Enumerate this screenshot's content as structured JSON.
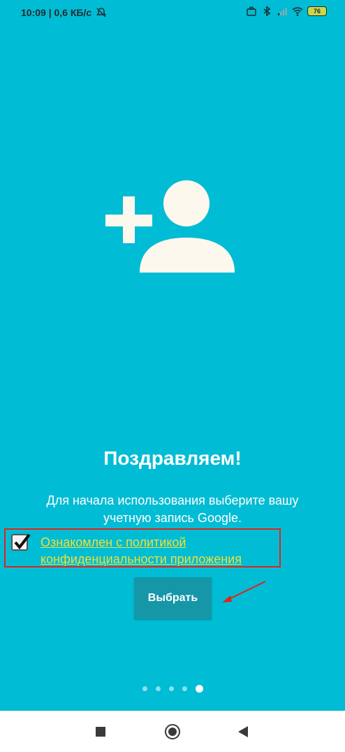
{
  "status_bar": {
    "time_speed": "10:09 | 0,6 КБ/с",
    "battery": "76",
    "icons": [
      "mute-bell-icon",
      "briefcase-icon",
      "bluetooth-icon",
      "signal-icon",
      "wifi-icon",
      "battery-icon"
    ]
  },
  "hero": {
    "icon": "add-person-icon",
    "color": "#FDF8EE"
  },
  "title": "Поздравляем!",
  "subtitle": "Для начала использования выберите вашу учетную запись Google.",
  "consent": {
    "checked": true,
    "link_text": "Ознакомлен с политикой конфиденциальности приложения"
  },
  "button": {
    "label": "Выбрать"
  },
  "pager": {
    "count": 5,
    "active_index": 4
  },
  "colors": {
    "background": "#00BCD4",
    "button": "#1597A8",
    "link": "#F0E034",
    "highlight": "#E0241B"
  },
  "nav_bar": {
    "icons": [
      "recents-square-icon",
      "home-circle-icon",
      "back-triangle-icon"
    ]
  }
}
